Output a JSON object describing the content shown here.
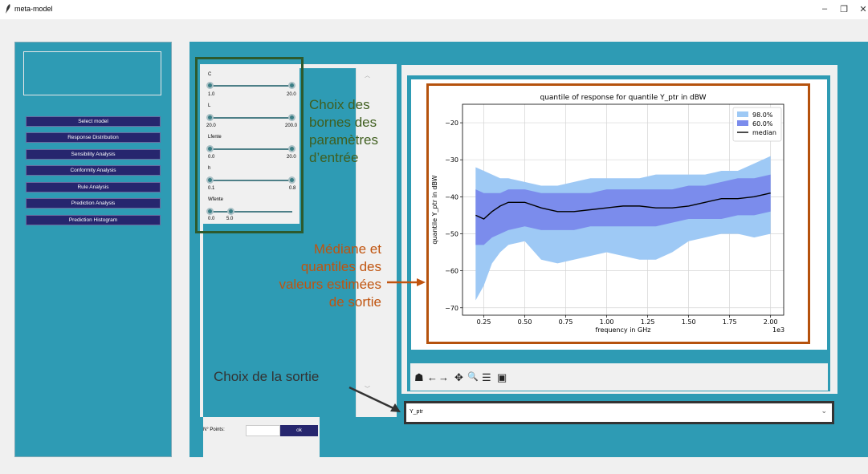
{
  "window": {
    "title": "meta-model",
    "minimize": "–",
    "restore": "❐",
    "close": "✕"
  },
  "sidebar": {
    "items": [
      {
        "label": "Select model"
      },
      {
        "label": "Response Distribution"
      },
      {
        "label": "Sensibility Analysis"
      },
      {
        "label": "Conformity Analysis"
      },
      {
        "label": "Rule Analysis"
      },
      {
        "label": "Prediction Analysis"
      },
      {
        "label": "Prediction Histogram"
      }
    ]
  },
  "sliders": [
    {
      "label": "C",
      "min_label": "1.0",
      "max_label": "20.0",
      "low": 0.0,
      "high": 1.0
    },
    {
      "label": "L",
      "min_label": "20.0",
      "max_label": "200.0",
      "low": 0.0,
      "high": 1.0
    },
    {
      "label": "Lfente",
      "min_label": "0.0",
      "max_label": "20.0",
      "low": 0.0,
      "high": 1.0
    },
    {
      "label": "h",
      "min_label": "0.1",
      "max_label": "0.8",
      "low": 0.0,
      "high": 1.0
    },
    {
      "label": "Wfente",
      "min_label": "0.0",
      "max_label": "5.0",
      "low": 0.0,
      "high": 0.25
    }
  ],
  "annotations": {
    "bounds": [
      "Choix des",
      "bornes des",
      "paramètres",
      "d’entrée"
    ],
    "median": [
      "Médiane et",
      "quantiles des",
      "valeurs estimées",
      "de sortie"
    ],
    "output": "Choix de la sortie",
    "green": "#3f5e1e",
    "orange": "#c0540f",
    "dark": "#333333"
  },
  "footer": {
    "npoints_label": "N° Points:",
    "npoints_value": "",
    "ok_label": "ok"
  },
  "output_select": {
    "value": "Y_ptr",
    "chevron": "⌄"
  },
  "toolbar": {
    "home": "☗",
    "back": "←",
    "forward": "→",
    "pan": "✥",
    "zoom": "🔍",
    "configure": "☰",
    "save": "▣"
  },
  "colors": {
    "teal": "#2e9bb4",
    "navy_button": "#26266e",
    "band_98": "#9ec9f5",
    "band_60": "#7b8cec",
    "median": "#000000"
  },
  "chart_data": {
    "type": "area",
    "title": "quantile of response for quantile Y_ptr in dBW",
    "xlabel": "frequency in GHz",
    "ylabel": "quantile Y_ptr in dBW",
    "x_offset_label": "1e3",
    "xlim": [
      0.12,
      2.08
    ],
    "ylim": [
      -72,
      -15
    ],
    "xticks": [
      0.25,
      0.5,
      0.75,
      1.0,
      1.25,
      1.5,
      1.75,
      2.0
    ],
    "xtick_labels": [
      "0.25",
      "0.50",
      "0.75",
      "1.00",
      "1.25",
      "1.50",
      "1.75",
      "2.00"
    ],
    "yticks": [
      -70,
      -60,
      -50,
      -40,
      -30,
      -20
    ],
    "ytick_labels": [
      "−70",
      "−60",
      "−50",
      "−40",
      "−30",
      "−20"
    ],
    "grid": true,
    "legend_position": "top-right",
    "x": [
      0.2,
      0.25,
      0.3,
      0.35,
      0.4,
      0.5,
      0.6,
      0.7,
      0.8,
      0.9,
      1.0,
      1.1,
      1.2,
      1.3,
      1.4,
      1.5,
      1.6,
      1.7,
      1.8,
      1.9,
      2.0
    ],
    "series": [
      {
        "name": "98.0%",
        "lower": [
          -68,
          -64,
          -58,
          -55,
          -53,
          -52,
          -57,
          -58,
          -57,
          -56,
          -55,
          -56,
          -57,
          -57,
          -55,
          -52,
          -51,
          -50,
          -50,
          -51,
          -50
        ],
        "upper": [
          -32,
          -33,
          -34,
          -35,
          -35,
          -36,
          -37,
          -37,
          -36,
          -35,
          -35,
          -35,
          -35,
          -34,
          -34,
          -34,
          -34,
          -33,
          -33,
          -31,
          -29
        ]
      },
      {
        "name": "60.0%",
        "lower": [
          -53,
          -53,
          -51,
          -50,
          -49,
          -48,
          -49,
          -49,
          -49,
          -48,
          -48,
          -48,
          -48,
          -48,
          -47,
          -46,
          -46,
          -46,
          -45,
          -45,
          -44
        ],
        "upper": [
          -38,
          -39,
          -39,
          -39,
          -38,
          -38,
          -39,
          -39,
          -39,
          -39,
          -38,
          -38,
          -38,
          -38,
          -38,
          -37,
          -37,
          -36,
          -35,
          -35,
          -34
        ]
      },
      {
        "name": "median",
        "values": [
          -45,
          -46,
          -44,
          -42.5,
          -41.5,
          -41.5,
          -43,
          -44,
          -44,
          -43.5,
          -43,
          -42.5,
          -42.5,
          -43,
          -43,
          -42.5,
          -41.5,
          -40.5,
          -40.5,
          -40,
          -39
        ]
      }
    ]
  }
}
